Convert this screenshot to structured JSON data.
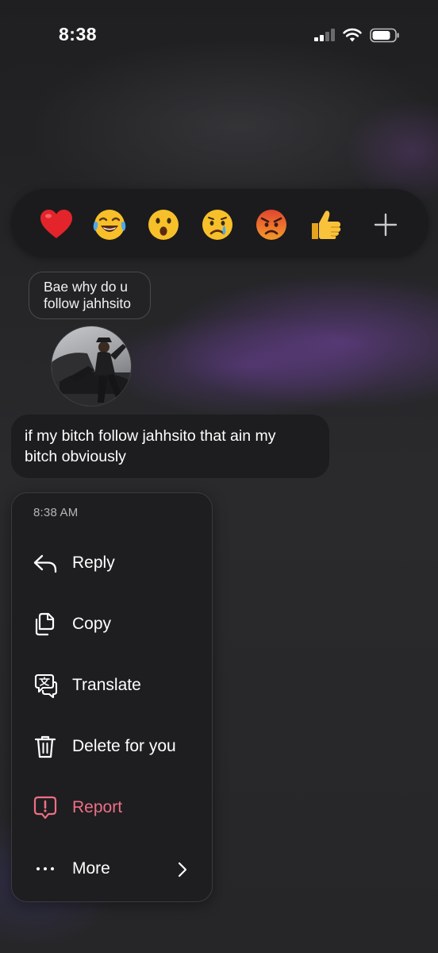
{
  "status_bar": {
    "time": "8:38",
    "signal_icon": "cellular-signal-icon",
    "wifi_icon": "wifi-icon",
    "battery_icon": "battery-icon"
  },
  "reactions": {
    "emojis": [
      {
        "name": "red-heart-icon",
        "glyph": "❤️"
      },
      {
        "name": "face-with-tears-of-joy-icon",
        "glyph": "😂"
      },
      {
        "name": "face-with-open-mouth-icon",
        "glyph": "😮"
      },
      {
        "name": "crying-face-icon",
        "glyph": "😢"
      },
      {
        "name": "angry-face-icon",
        "glyph": "😡"
      },
      {
        "name": "thumbs-up-icon",
        "glyph": "👍"
      }
    ],
    "add_icon": "plus-icon"
  },
  "thread": {
    "quoted_message": {
      "line1": "Bae why do u",
      "line2": "follow jahhsito"
    },
    "shared_image": "profile-photo",
    "message": {
      "line1": "if my bitch follow jahhsito that ain my",
      "line2": "bitch obviously"
    }
  },
  "context_menu": {
    "timestamp": "8:38 AM",
    "items": [
      {
        "label": "Reply",
        "icon": "reply-arrow-icon"
      },
      {
        "label": "Copy",
        "icon": "copy-icon"
      },
      {
        "label": "Translate",
        "icon": "translate-icon"
      },
      {
        "label": "Delete for you",
        "icon": "trash-icon"
      },
      {
        "label": "Report",
        "icon": "report-icon"
      },
      {
        "label": "More",
        "icon": "more-dots-icon"
      }
    ]
  },
  "colors": {
    "background": "#252527",
    "surface": "#1e1e20",
    "danger": "#ef6f86",
    "accent_purple": "#7a46aa"
  }
}
